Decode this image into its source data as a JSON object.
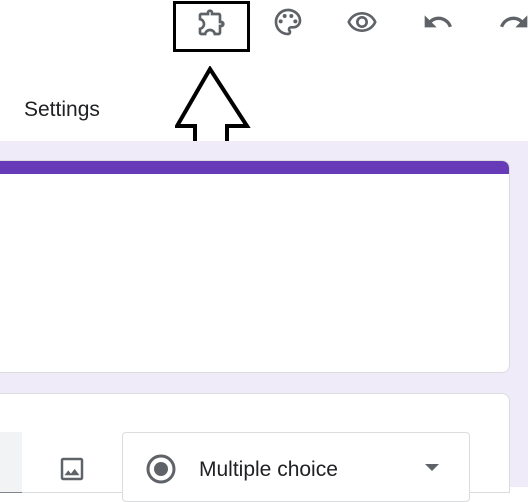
{
  "toolbar": {
    "icons": [
      "puzzle-piece-icon",
      "palette-icon",
      "eye-icon",
      "undo-icon",
      "redo-icon"
    ]
  },
  "tabs": {
    "settings_label": "Settings"
  },
  "form": {
    "accent_color": "#673ab7",
    "background_color": "#f0ebf8"
  },
  "question": {
    "type_label": "Multiple choice",
    "type_icon": "radio-button-icon"
  }
}
